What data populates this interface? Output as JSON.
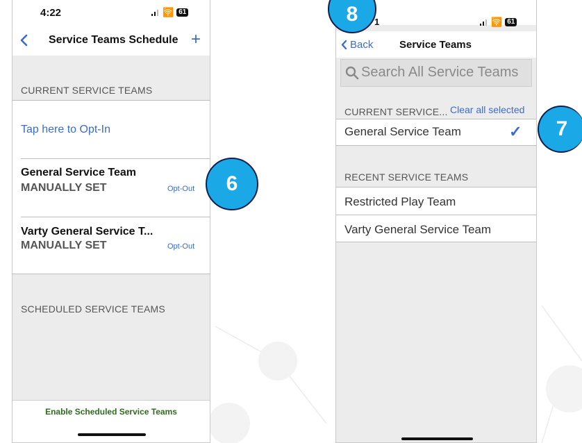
{
  "left_phone": {
    "status_time": "4:22",
    "battery": "61",
    "nav": {
      "back_icon": "chevron-left-icon",
      "title": "Service Teams Schedule",
      "add": "+"
    },
    "current_header": "CURRENT SERVICE TEAMS",
    "opt_in": "Tap here to Opt-In",
    "teams": [
      {
        "name": "General Service Team",
        "status": "MANUALLY SET",
        "action": "Opt-Out"
      },
      {
        "name": "Varty General Service T...",
        "status": "MANUALLY SET",
        "action": "Opt-Out"
      }
    ],
    "scheduled_header": "SCHEDULED SERVICE TEAMS",
    "enable_button": "Enable Scheduled Service Teams"
  },
  "right_phone": {
    "status_time": "1",
    "battery": "61",
    "nav": {
      "back": "Back",
      "title": "Service Teams"
    },
    "search_placeholder": "Search All Service Teams",
    "current_header": "CURRENT SERVICE...",
    "clear_all": "Clear all selected",
    "current_teams": [
      "General Service Team"
    ],
    "checkmark": "✓",
    "recent_header": "RECENT SERVICE TEAMS",
    "recent_teams": [
      "Restricted Play Team",
      "Varty General Service Team"
    ]
  },
  "callouts": [
    "6",
    "7",
    "8"
  ],
  "colors": {
    "accent": "#3a6bd0",
    "callout": "#1aa9e6",
    "callout_border": "#0e1e4a",
    "enable_text": "#2e6b1f"
  }
}
